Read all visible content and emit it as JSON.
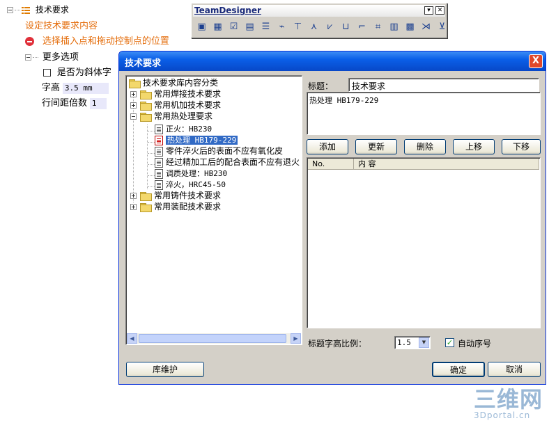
{
  "left_panel": {
    "root_label": "技术要求",
    "instruction": "设定技术要求内容",
    "prompt": "选择插入点和拖动控制点的位置",
    "more_options": "更多选项",
    "italic_label": "是否为斜体字",
    "font_height_label": "字高",
    "font_height_value": "3.5 mm",
    "line_spacing_label": "行间距倍数",
    "line_spacing_value": "1"
  },
  "toolbar": {
    "title": "TeamDesigner",
    "menu_btn": "▾",
    "close_btn": "✕",
    "tools": [
      {
        "icon": "▣"
      },
      {
        "icon": "▦"
      },
      {
        "icon": "☑"
      },
      {
        "icon": "▤"
      },
      {
        "icon": "☰"
      },
      {
        "icon": "⌁"
      },
      {
        "icon": "⊤"
      },
      {
        "icon": "⋏"
      },
      {
        "icon": "⩗"
      },
      {
        "icon": "⊔"
      },
      {
        "icon": "⌐"
      },
      {
        "icon": "⌗"
      },
      {
        "icon": "▥"
      },
      {
        "icon": "▩"
      },
      {
        "icon": "⋊"
      },
      {
        "icon": "⊻"
      }
    ]
  },
  "dialog": {
    "title": "技术要求",
    "close": "X",
    "tree": {
      "root": "技术要求库内容分类",
      "cat_welding": "常用焊接技术要求",
      "cat_machining": "常用机加技术要求",
      "cat_heat": "常用热处理要求",
      "heat_items": [
        "正火：HB230",
        "热处理  HB179-229",
        "零件淬火后的表面不应有氧化皮",
        "经过精加工后的配合表面不应有退火",
        "调质处理：HB230",
        "淬火，HRC45-50"
      ],
      "cat_casting": "常用铸件技术要求",
      "cat_assembly": "常用装配技术要求"
    },
    "title_label": "标题：",
    "title_value": "技术要求",
    "content_value": "热处理  HB179-229",
    "buttons": {
      "add": "添加",
      "update": "更新",
      "delete": "删除",
      "up": "上移",
      "down": "下移",
      "library": "库维护",
      "ok": "确定",
      "cancel": "取消"
    },
    "list_header": {
      "no": "No.",
      "content": "内  容"
    },
    "ratio_label": "标题字高比例：",
    "ratio_value": "1.5",
    "auto_number_label": "自动序号",
    "auto_number_checked": "✓"
  },
  "watermark": {
    "big": "三维网",
    "small": "3Dportal.cn"
  }
}
